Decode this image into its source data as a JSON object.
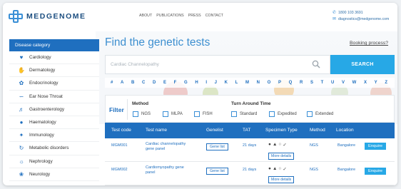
{
  "header": {
    "logo_text": "MEDGENOME",
    "nav": [
      "ABOUT",
      "PUBLICATIONS",
      "PRESS",
      "CONTACT"
    ],
    "phone": "1800 103 3691",
    "email": "diagnostics@medgenome.com"
  },
  "sidebar": {
    "heading": "Disease category",
    "items": [
      {
        "label": "Cardiology",
        "icon": "heart-icon"
      },
      {
        "label": "Dermatology",
        "icon": "skin-icon"
      },
      {
        "label": "Endocrinology",
        "icon": "gland-icon"
      },
      {
        "label": "Ear Nose Throat",
        "icon": "ear-icon"
      },
      {
        "label": "Gastroenterology",
        "icon": "stomach-icon"
      },
      {
        "label": "Haematology",
        "icon": "blood-drop-icon"
      },
      {
        "label": "Immunology",
        "icon": "antibody-icon"
      },
      {
        "label": "Metabolic disorders",
        "icon": "metabolic-icon"
      },
      {
        "label": "Nephrology",
        "icon": "kidney-icon"
      },
      {
        "label": "Neurology",
        "icon": "brain-icon"
      }
    ]
  },
  "main": {
    "title": "Find the genetic tests",
    "booking_link": "Booking process?",
    "search": {
      "placeholder": "Cardiac Channelopathy",
      "button": "SEARCH"
    },
    "alphabet": [
      "#",
      "A",
      "B",
      "C",
      "D",
      "E",
      "F",
      "G",
      "H",
      "I",
      "J",
      "K",
      "L",
      "M",
      "N",
      "O",
      "P",
      "Q",
      "R",
      "S",
      "T",
      "U",
      "V",
      "W",
      "X",
      "Y",
      "Z"
    ],
    "filter": {
      "label": "Filter",
      "method_title": "Method",
      "methods": [
        "NGS",
        "MLPA",
        "FISH"
      ],
      "tat_title": "Turn Around Time",
      "tat_options": [
        "Standard",
        "Expedited",
        "Extended"
      ]
    },
    "table": {
      "headers": [
        "Test code",
        "Test name",
        "Genelist",
        "TAT",
        "Specimen Type",
        "Method",
        "Location"
      ],
      "rows": [
        {
          "code": "MGM001",
          "name": "Cardiac channelopathy gene panel",
          "genelist": "Gene list",
          "tat": "21 days",
          "more": "More details",
          "method": "NGS",
          "location": "Bangalore",
          "action": "Enquire"
        },
        {
          "code": "MGM002",
          "name": "Cardiomyopathy gene panel",
          "genelist": "Gene list",
          "tat": "21 days",
          "more": "More details",
          "method": "NGS",
          "location": "Bangalore",
          "action": "Enquire"
        }
      ]
    }
  },
  "colors": {
    "primary": "#1f6fbf",
    "accent": "#27a8e6",
    "title": "#3d8fd0"
  }
}
